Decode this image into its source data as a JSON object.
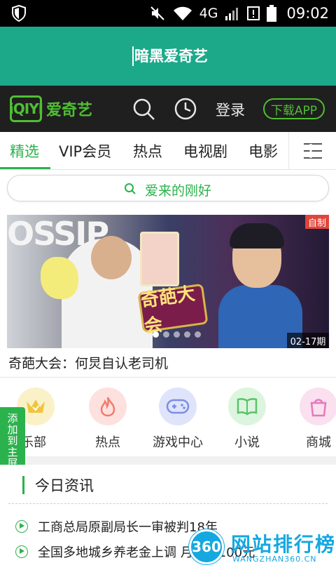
{
  "status_bar": {
    "network": "4G",
    "time": "09:02"
  },
  "search_header": {
    "query": "暗黑爱奇艺"
  },
  "app_bar": {
    "logo_mark": "iQIYI",
    "logo_text": "爱奇艺",
    "login_label": "登录",
    "download_label": "下载APP"
  },
  "tabs": [
    {
      "label": "精选",
      "active": true
    },
    {
      "label": "VIP会员",
      "active": false
    },
    {
      "label": "热点",
      "active": false
    },
    {
      "label": "电视剧",
      "active": false
    },
    {
      "label": "电影",
      "active": false
    }
  ],
  "search_box": {
    "placeholder": "爱来的刚好"
  },
  "banner": {
    "text": "OSSIP",
    "sticker_text": "奇葩大会",
    "badge": "自制",
    "date": "02-17期",
    "caption": "奇葩大会：何炅自认老司机"
  },
  "categories": [
    {
      "label": "俱乐部",
      "icon": "crown-icon",
      "color": "#fbf1c8"
    },
    {
      "label": "热点",
      "icon": "flame-icon",
      "color": "#fde1df"
    },
    {
      "label": "游戏中心",
      "icon": "gamepad-icon",
      "color": "#dfe4fb"
    },
    {
      "label": "小说",
      "icon": "book-icon",
      "color": "#dcf5df"
    },
    {
      "label": "商城",
      "icon": "shopping-bag-icon",
      "color": "#fbe0f0"
    }
  ],
  "side_tab": {
    "label": "添加到主屏幕"
  },
  "section": {
    "title": "今日资讯"
  },
  "news": [
    {
      "title": "工商总局原副局长一审被判18年"
    },
    {
      "title": "全国多地城乡养老金上调 月均超100元"
    }
  ],
  "watermark": {
    "badge": "360",
    "main": "网站排行榜",
    "sub": "WANGZHAN360.CN"
  },
  "colors": {
    "header_green": "#1ca98a",
    "accent_green": "#2bb24c",
    "appbar_dark": "#1f1f1f",
    "badge_red": "#e0453b",
    "watermark_blue": "#15a8e0"
  }
}
